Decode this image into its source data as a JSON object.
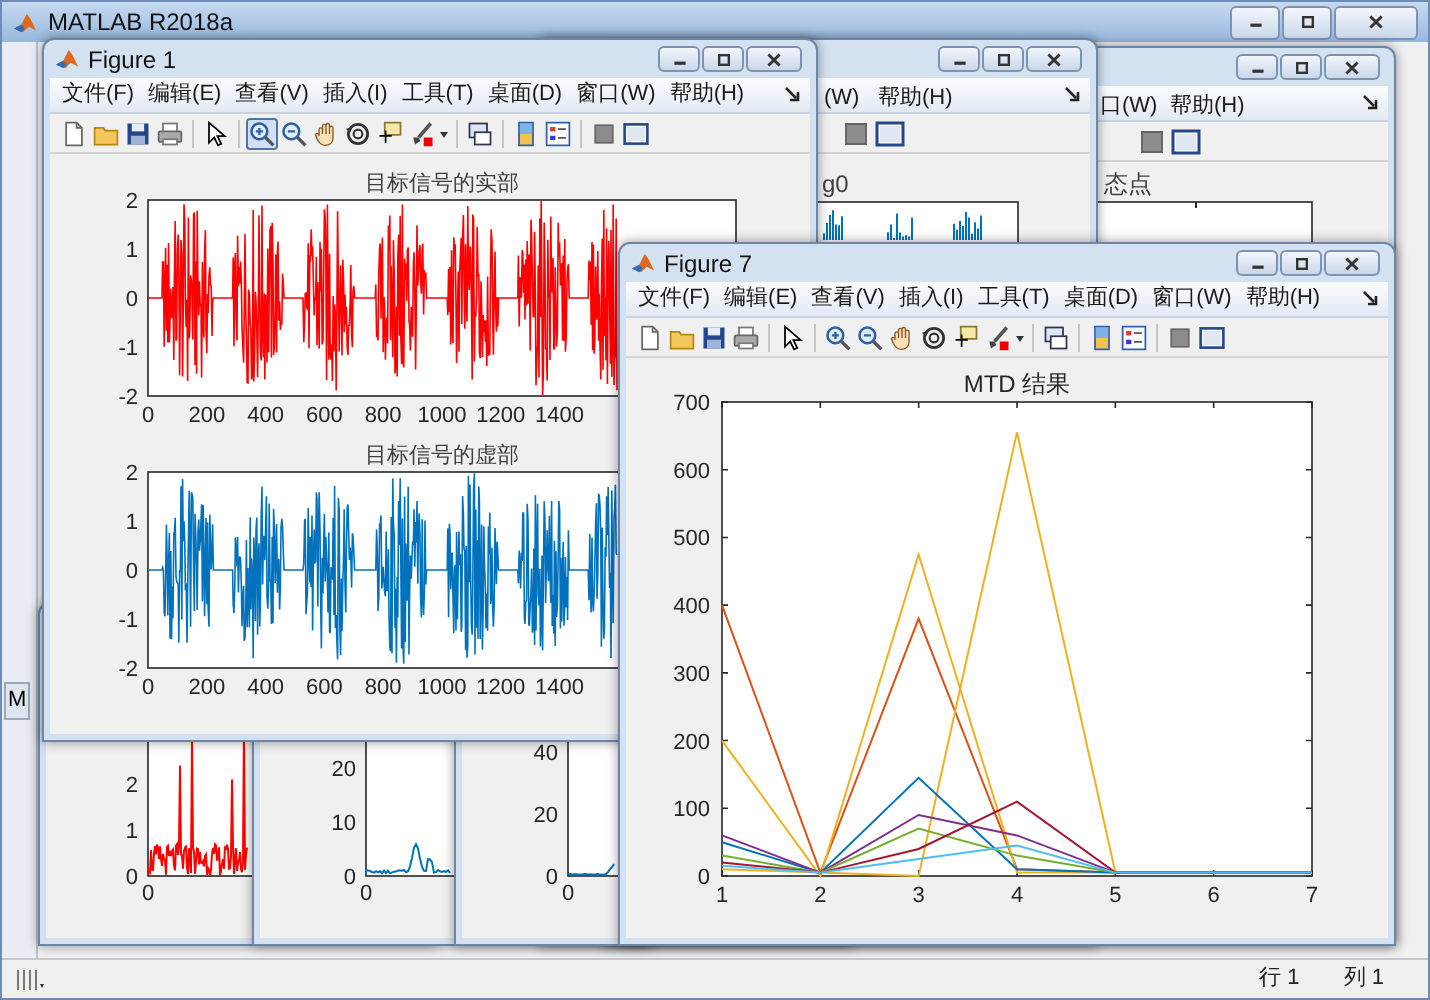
{
  "main_window": {
    "title": "MATLAB R2018a",
    "side_tab": "M",
    "status_bar": [
      "行 1",
      "列 1"
    ]
  },
  "figure_window_top_right": {
    "menu": [
      "口(W)",
      "帮助(H)"
    ],
    "plot_title": "态点"
  },
  "figure_window_top_middle": {
    "menu": [
      "(W)",
      "帮助(H)"
    ],
    "plot_title": "g0"
  },
  "figure_window_bottom_left": {
    "y_ticks": [
      "2",
      "1",
      "0"
    ],
    "x_ticks": [
      "0"
    ]
  },
  "figure_window_bottom_middle": {
    "y_ticks": [
      "20",
      "10",
      "0"
    ],
    "x_ticks": [
      "0"
    ]
  },
  "figure_window_bottom_right": {
    "y_ticks": [
      "40",
      "20",
      "0"
    ],
    "x_ticks": [
      "0"
    ]
  },
  "figure_1": {
    "title": "Figure 1",
    "menu": [
      "文件(F)",
      "编辑(E)",
      "查看(V)",
      "插入(I)",
      "工具(T)",
      "桌面(D)",
      "窗口(W)",
      "帮助(H)"
    ],
    "zoom_in_pressed": true,
    "plots": [
      {
        "title": "目标信号的实部",
        "color": "#ff0000",
        "y_ticks": [
          "2",
          "1",
          "0",
          "-1",
          "-2"
        ],
        "x_ticks": [
          "0",
          "200",
          "400",
          "600",
          "800",
          "1000",
          "1200",
          "1400"
        ]
      },
      {
        "title": "目标信号的虚部",
        "color": "#0072bd",
        "y_ticks": [
          "2",
          "1",
          "0",
          "-1",
          "-2"
        ],
        "x_ticks": [
          "0",
          "200",
          "400",
          "600",
          "800",
          "1000",
          "1200",
          "1400"
        ]
      }
    ]
  },
  "figure_7": {
    "title": "Figure 7",
    "menu": [
      "文件(F)",
      "编辑(E)",
      "查看(V)",
      "插入(I)",
      "工具(T)",
      "桌面(D)",
      "窗口(W)",
      "帮助(H)"
    ],
    "zoom_in_pressed": false,
    "chart_data": {
      "type": "line",
      "title": "MTD 结果",
      "x": [
        1,
        2,
        3,
        4,
        5,
        6,
        7
      ],
      "xlim": [
        1,
        7
      ],
      "ylim": [
        0,
        700
      ],
      "xticks": [
        1,
        2,
        3,
        4,
        5,
        6,
        7
      ],
      "yticks": [
        0,
        100,
        200,
        300,
        400,
        500,
        600,
        700
      ],
      "series": [
        {
          "color": "#d95319",
          "values": [
            400,
            5,
            380,
            10,
            5,
            5,
            5
          ]
        },
        {
          "color": "#edb120",
          "values": [
            200,
            0,
            475,
            5,
            5,
            5,
            5
          ]
        },
        {
          "color": "#edb120",
          "values": [
            10,
            5,
            0,
            655,
            5,
            5,
            5
          ]
        },
        {
          "color": "#0072bd",
          "values": [
            50,
            5,
            145,
            10,
            5,
            5,
            5
          ]
        },
        {
          "color": "#7e2f8e",
          "values": [
            60,
            5,
            90,
            60,
            5,
            5,
            5
          ]
        },
        {
          "color": "#77ac30",
          "values": [
            30,
            5,
            70,
            30,
            5,
            5,
            5
          ]
        },
        {
          "color": "#a2142f",
          "values": [
            20,
            5,
            40,
            110,
            5,
            5,
            5
          ]
        },
        {
          "color": "#4dbeee",
          "values": [
            15,
            5,
            25,
            45,
            5,
            5,
            5
          ]
        }
      ]
    }
  }
}
